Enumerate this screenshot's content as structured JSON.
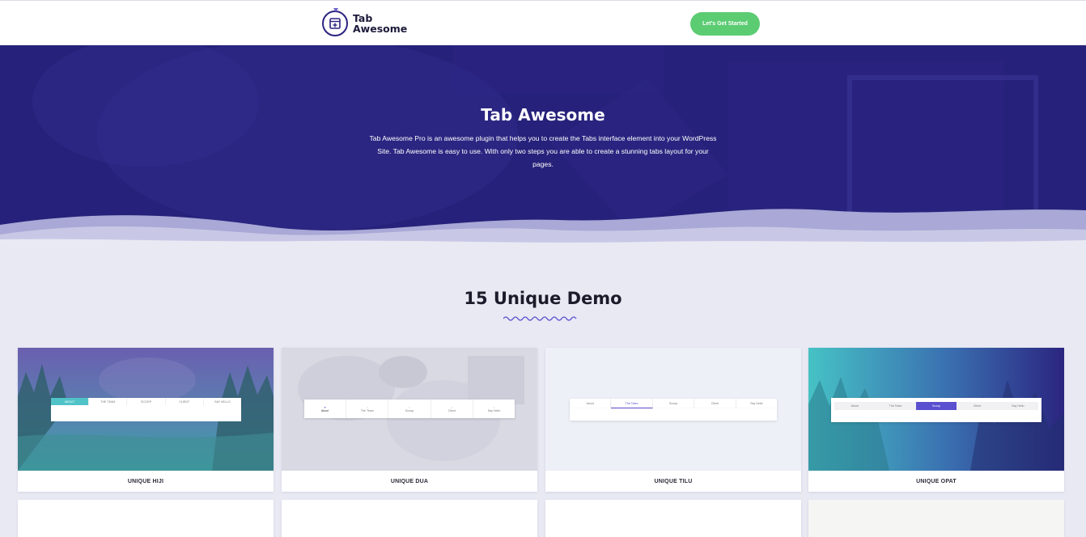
{
  "header": {
    "logo_line1": "Tab",
    "logo_line2": "Awesome",
    "cta_label": "Let's Get Started"
  },
  "hero": {
    "title": "Tab Awesome",
    "description": "Tab Awesome Pro is an awesome plugin that helps you to create the Tabs interface element into your WordPress Site. Tab Awesome is easy to use. With only two steps you are able to create a stunning tabs layout for your pages."
  },
  "demos": {
    "title": "15 Unique Demo",
    "cards": [
      {
        "label": "UNIQUE HIJI",
        "tabs": [
          "ABOUT",
          "THE TEAM",
          "SCOOP",
          "CLIENT",
          "SAY HELLO"
        ]
      },
      {
        "label": "UNIQUE DUA",
        "tabs": [
          "About",
          "The Team",
          "Scoop",
          "Client",
          "Say Hello"
        ]
      },
      {
        "label": "UNIQUE TILU",
        "tabs": [
          "About",
          "The Team",
          "Scoop",
          "Client",
          "Say Hello"
        ]
      },
      {
        "label": "UNIQUE OPAT",
        "tabs": [
          "About",
          "The Team",
          "Scoop",
          "Client",
          "Say Hello"
        ]
      }
    ]
  },
  "colors": {
    "hero_bg": "#26217a",
    "cta": "#5ccc73",
    "accent": "#5a4fcf",
    "teal": "#4fc3c8",
    "page_bg": "#e8e9f3"
  }
}
